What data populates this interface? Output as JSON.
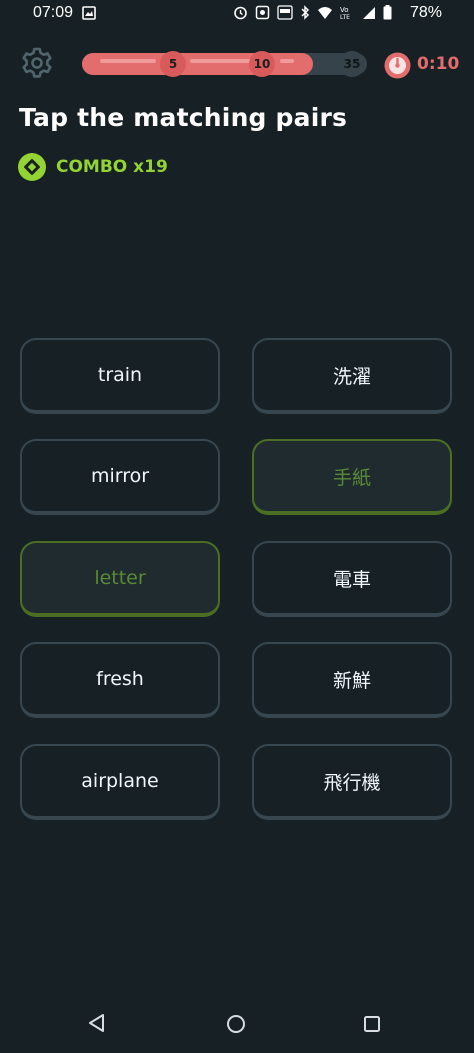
{
  "status_bar": {
    "time": "07:09",
    "battery": "78%",
    "icons": [
      "image-icon",
      "alarm-icon",
      "screenshot-icon",
      "auto-icon",
      "bluetooth-icon",
      "wifi-icon",
      "volte-icon",
      "signal-icon",
      "battery-icon"
    ]
  },
  "header": {
    "progress": {
      "milestones": [
        "5",
        "10",
        "35"
      ],
      "reached_fraction": 0.81
    },
    "timer": "0:10"
  },
  "title": "Tap the matching pairs",
  "combo": "COMBO x19",
  "cards": {
    "left": [
      {
        "label": "train",
        "state": "normal"
      },
      {
        "label": "mirror",
        "state": "normal"
      },
      {
        "label": "letter",
        "state": "selected"
      },
      {
        "label": "fresh",
        "state": "normal"
      },
      {
        "label": "airplane",
        "state": "normal"
      }
    ],
    "right": [
      {
        "label": "洗濯",
        "state": "normal"
      },
      {
        "label": "手紙",
        "state": "selected"
      },
      {
        "label": "電車",
        "state": "normal"
      },
      {
        "label": "新鮮",
        "state": "normal"
      },
      {
        "label": "飛行機",
        "state": "normal"
      }
    ]
  },
  "colors": {
    "background": "#162025",
    "progress_fill": "#e36c6c",
    "combo": "#93d333",
    "selected_border": "#4b6e23"
  },
  "nav_bar": {
    "icons": [
      "back-icon",
      "home-icon",
      "recents-icon"
    ]
  }
}
